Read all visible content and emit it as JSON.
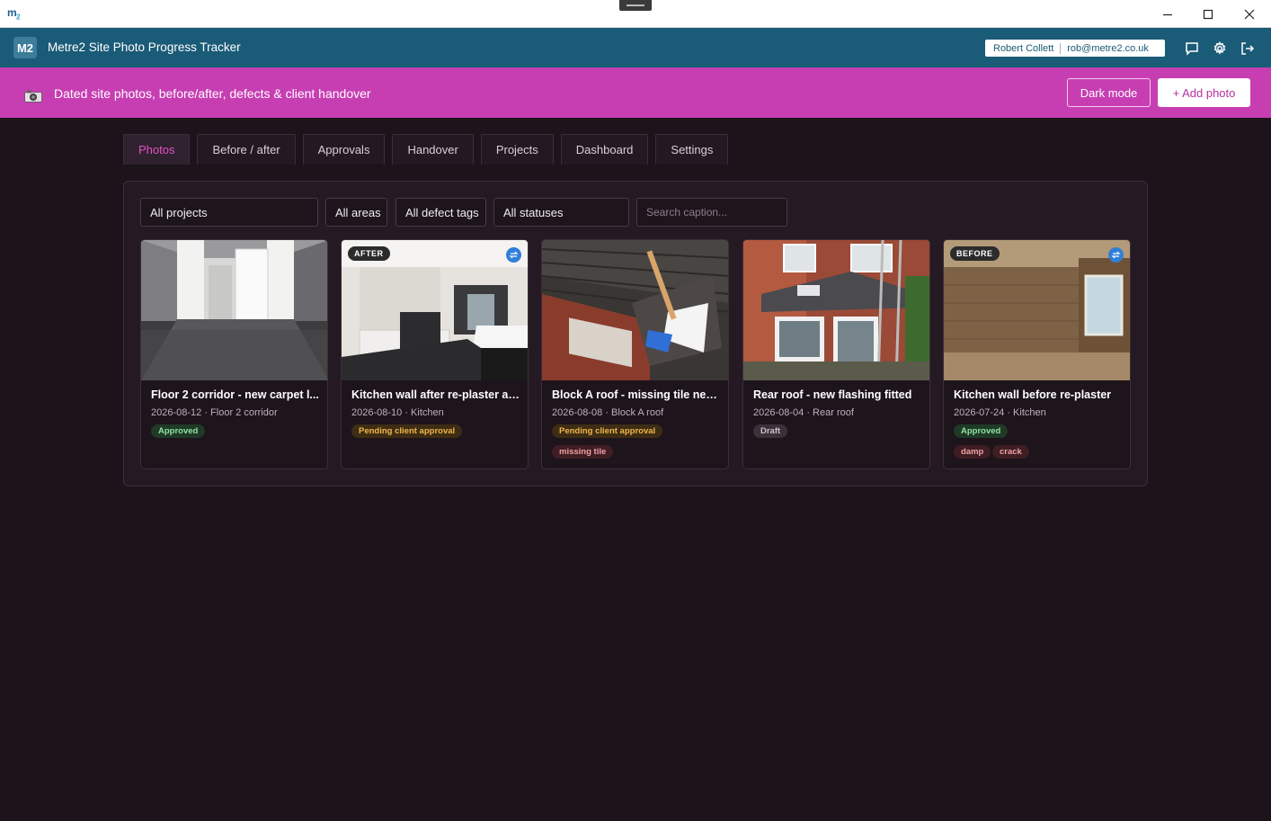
{
  "titlebar": {
    "logo": "m",
    "logo_sub": "2",
    "minimize_icon": "minimize-icon",
    "maximize_icon": "maximize-icon",
    "close_icon": "close-icon"
  },
  "header": {
    "badge": "M2",
    "title": "Metre2 Site Photo Progress Tracker",
    "user_name": "Robert Collett",
    "user_email": "rob@metre2.co.uk",
    "icons": [
      "chat-icon",
      "gear-icon",
      "logout-icon"
    ]
  },
  "banner": {
    "text": "Dated site photos, before/after, defects & client handover",
    "camera_icon": "camera-icon",
    "dark_mode_label": "Dark mode",
    "add_photo_label": "+ Add photo",
    "color": "#c73eb3"
  },
  "tabs": [
    {
      "label": "Photos",
      "active": true
    },
    {
      "label": "Before / after",
      "active": false
    },
    {
      "label": "Approvals",
      "active": false
    },
    {
      "label": "Handover",
      "active": false
    },
    {
      "label": "Projects",
      "active": false
    },
    {
      "label": "Dashboard",
      "active": false
    },
    {
      "label": "Settings",
      "active": false
    }
  ],
  "filters": {
    "projects": "All projects",
    "areas": "All areas",
    "defect_tags": "All defect tags",
    "statuses": "All statuses",
    "search_placeholder": "Search caption..."
  },
  "photos": [
    {
      "title": "Floor 2 corridor - new carpet l...",
      "date": "2026-08-12",
      "area": "Floor 2 corridor",
      "meta": "2026-08-12 · Floor 2 corridor",
      "status": "Approved",
      "label": "",
      "tags": []
    },
    {
      "title": "Kitchen wall after re-plaster an...",
      "date": "2026-08-10",
      "area": "Kitchen",
      "meta": "2026-08-10 · Kitchen",
      "status": "Pending client approval",
      "label": "AFTER",
      "tags": []
    },
    {
      "title": "Block A roof - missing tile near...",
      "date": "2026-08-08",
      "area": "Block A roof",
      "meta": "2026-08-08 · Block A roof",
      "status": "Pending client approval",
      "label": "",
      "tags": [
        "missing tile"
      ]
    },
    {
      "title": "Rear roof - new flashing fitted",
      "date": "2026-08-04",
      "area": "Rear roof",
      "meta": "2026-08-04 · Rear roof",
      "status": "Draft",
      "label": "",
      "tags": []
    },
    {
      "title": "Kitchen wall before re-plaster",
      "date": "2026-07-24",
      "area": "Kitchen",
      "meta": "2026-07-24 · Kitchen",
      "status": "Approved",
      "label": "BEFORE",
      "tags": [
        "damp",
        "crack"
      ]
    }
  ]
}
